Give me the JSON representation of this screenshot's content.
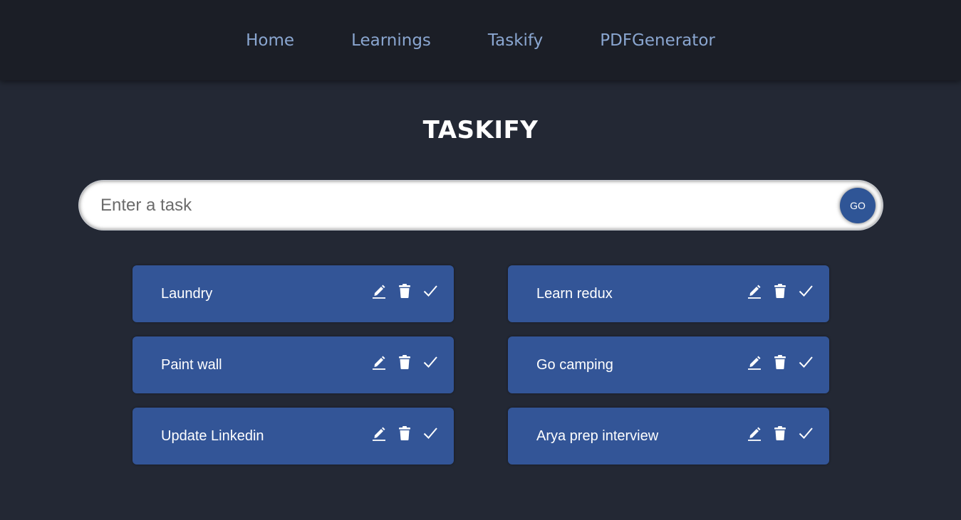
{
  "nav": {
    "links": [
      "Home",
      "Learnings",
      "Taskify",
      "PDFGenerator"
    ]
  },
  "page": {
    "title": "TASKIFY"
  },
  "task_input": {
    "placeholder": "Enter a task",
    "value": "",
    "go_label": "GO"
  },
  "tasks": [
    {
      "label": "Laundry"
    },
    {
      "label": "Learn redux"
    },
    {
      "label": "Paint wall"
    },
    {
      "label": "Go camping"
    },
    {
      "label": "Update Linkedin"
    },
    {
      "label": "Arya prep interview"
    }
  ],
  "task_actions": [
    "edit-icon",
    "delete-icon",
    "done-icon"
  ],
  "colors": {
    "background": "#232834",
    "navbar": "#1b1e26",
    "nav_link": "#8aa6d0",
    "card": "#335597",
    "go_button": "#2f5596"
  }
}
